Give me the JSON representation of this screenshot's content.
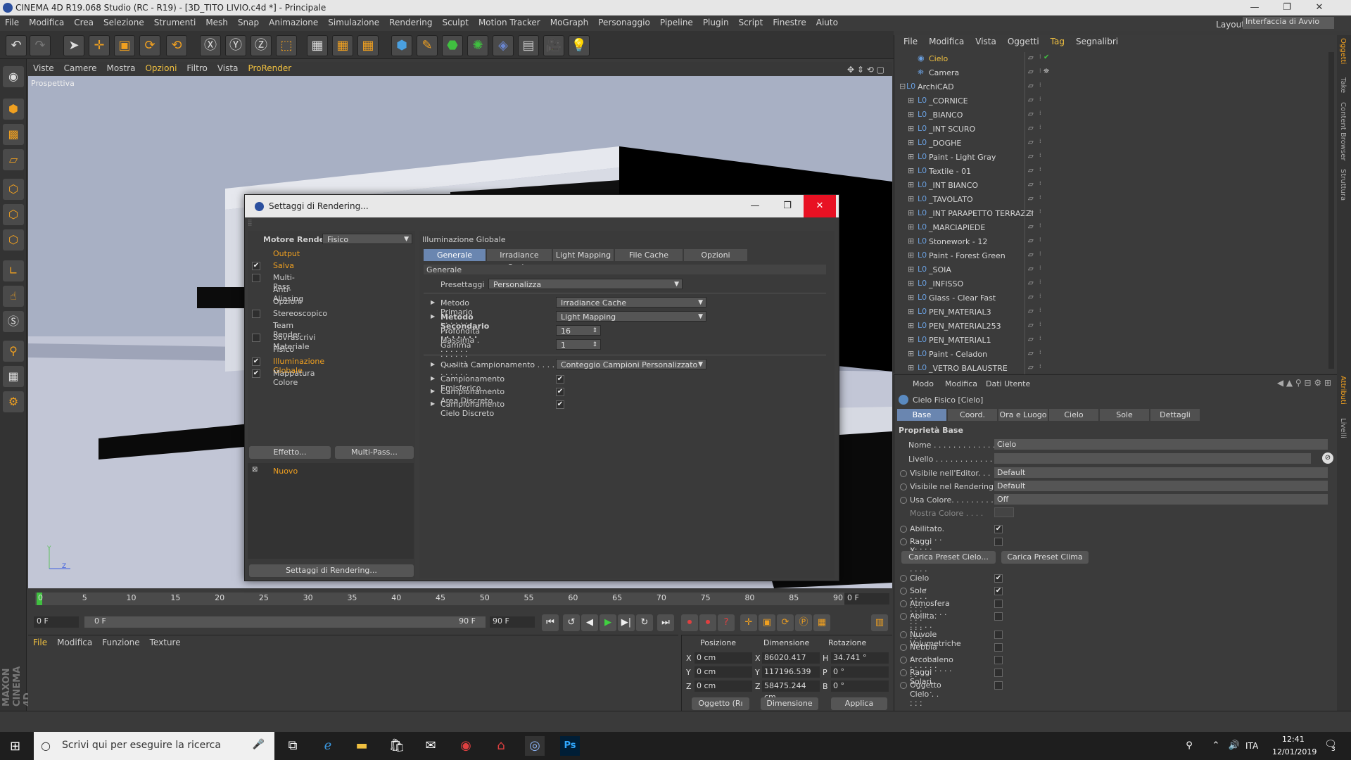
{
  "window": {
    "title": "CINEMA 4D R19.068 Studio (RC - R19) - [3D_TITO LIVIO.c4d *] - Principale",
    "controls": [
      "—",
      "❐",
      "✕"
    ]
  },
  "menubar": {
    "items": [
      "File",
      "Modifica",
      "Crea",
      "Selezione",
      "Strumenti",
      "Mesh",
      "Snap",
      "Animazione",
      "Simulazione",
      "Rendering",
      "Sculpt",
      "Motion Tracker",
      "MoGraph",
      "Personaggio",
      "Pipeline",
      "Plugin",
      "Script",
      "Finestre",
      "Aiuto"
    ],
    "layout_label": "Layout:",
    "layout_value": "Interfaccia di Avvio"
  },
  "viewport": {
    "menu": [
      "Viste",
      "Camere",
      "Mostra",
      "Opzioni",
      "Filtro",
      "Vista",
      "ProRender"
    ],
    "label": "Prospettiva",
    "axis_y": "Y",
    "axis_z": "Z"
  },
  "timeline": {
    "ticks": [
      "0",
      "5",
      "10",
      "15",
      "20",
      "25",
      "30",
      "35",
      "40",
      "45",
      "50",
      "55",
      "60",
      "65",
      "70",
      "75",
      "80",
      "85",
      "90"
    ],
    "frame_end_box": "0 F",
    "start": "0 F",
    "range_start": "0 F",
    "range_end": "90 F",
    "end": "90 F"
  },
  "material_manager": {
    "menu": [
      "File",
      "Modifica",
      "Funzione",
      "Texture"
    ]
  },
  "coordinates": {
    "headers": [
      "Posizione",
      "Dimensione",
      "Rotazione"
    ],
    "rows": [
      {
        "axis": "X",
        "pos": "0 cm",
        "dim_axis": "X",
        "dim": "86020.417 cm",
        "rot_axis": "H",
        "rot": "34.741 °"
      },
      {
        "axis": "Y",
        "pos": "0 cm",
        "dim_axis": "Y",
        "dim": "117196.539 cı",
        "rot_axis": "P",
        "rot": "0 °"
      },
      {
        "axis": "Z",
        "pos": "0 cm",
        "dim_axis": "Z",
        "dim": "58475.244 cm",
        "rot_axis": "B",
        "rot": "0 °"
      }
    ],
    "mode_select": "Oggetto (Rı",
    "size_select": "Dimensione",
    "apply": "Applica"
  },
  "object_manager": {
    "menu": [
      "File",
      "Modifica",
      "Vista",
      "Oggetti",
      "Tag",
      "Segnalibri"
    ],
    "objects": [
      {
        "name": "Cielo",
        "expand": ""
      },
      {
        "name": "Camera",
        "expand": ""
      },
      {
        "name": "ArchiCAD",
        "expand": "⊟"
      },
      {
        "name": "_CORNICE",
        "expand": "⊞"
      },
      {
        "name": "_BIANCO",
        "expand": "⊞"
      },
      {
        "name": "_INT SCURO",
        "expand": "⊞"
      },
      {
        "name": "_DOGHE",
        "expand": "⊞"
      },
      {
        "name": "Paint - Light Gray",
        "expand": "⊞"
      },
      {
        "name": "Textile - 01",
        "expand": "⊞"
      },
      {
        "name": "_INT BIANCO",
        "expand": "⊞"
      },
      {
        "name": "_TAVOLATO",
        "expand": "⊞"
      },
      {
        "name": "_INT PARAPETTO TERRAZZI",
        "expand": "⊞"
      },
      {
        "name": "_MARCIAPIEDE",
        "expand": "⊞"
      },
      {
        "name": "Stonework - 12",
        "expand": "⊞"
      },
      {
        "name": "Paint - Forest Green",
        "expand": "⊞"
      },
      {
        "name": "_SOIA",
        "expand": "⊞"
      },
      {
        "name": "_INFISSO",
        "expand": "⊞"
      },
      {
        "name": "Glass - Clear Fast",
        "expand": "⊞"
      },
      {
        "name": "PEN_MATERIAL3",
        "expand": "⊞"
      },
      {
        "name": "PEN_MATERIAL253",
        "expand": "⊞"
      },
      {
        "name": "PEN_MATERIAL1",
        "expand": "⊞"
      },
      {
        "name": "Paint - Celadon",
        "expand": "⊞"
      },
      {
        "name": "_VETRO BALAUSTRE",
        "expand": "⊞"
      }
    ]
  },
  "attribute_manager": {
    "menu": [
      "Modo",
      "Modifica",
      "Dati Utente"
    ],
    "object_title": "Cielo Fisico [Cielo]",
    "tabs": [
      "Base",
      "Coord.",
      "Ora e Luogo",
      "Cielo",
      "Sole",
      "Dettagli"
    ],
    "section": "Proprietà Base",
    "fields": [
      {
        "label": "Nome . . . . . . . . . . . . . . .",
        "value": "Cielo"
      },
      {
        "label": "Livello . . . . . . . . . . . . . .",
        "value": ""
      },
      {
        "label": "Visibile nell'Editor. . .",
        "value": "Default"
      },
      {
        "label": "Visibile nel Rendering",
        "value": "Default"
      },
      {
        "label": "Usa Colore. . . . . . . . . .",
        "value": "Off"
      },
      {
        "label": "Mostra Colore . . . .",
        "value": ""
      }
    ],
    "checks1": [
      {
        "label": "Abilitato. . . . . . . . . . . . .",
        "checked": "✔"
      },
      {
        "label": "Raggi X. . . . . . . . . . . . . .",
        "checked": ""
      }
    ],
    "preset_buttons": [
      "Carica Preset Cielo...",
      "Carica Preset Clima"
    ],
    "checks2": [
      {
        "label": "Cielo . . . . . . . . . . . . . . . .",
        "checked": "✔"
      },
      {
        "label": "Sole . . . . . . . . . . . . . . . .",
        "checked": "✔"
      },
      {
        "label": "Atmosfera . . . . . . . . . .",
        "checked": ""
      },
      {
        "label": "Abilita. . . . . . . . . . . . . .",
        "checked": ""
      }
    ],
    "checks3": [
      {
        "label": "Nuvole Volumetriche",
        "checked": ""
      },
      {
        "label": "Nebbia . . . . . . . . . . . . . .",
        "checked": ""
      },
      {
        "label": "Arcobaleno . . . . . . . . .",
        "checked": ""
      },
      {
        "label": "Raggi Solari. . . . . . . . .",
        "checked": ""
      },
      {
        "label": "Oggetto Cielo . . . . .",
        "checked": ""
      }
    ]
  },
  "right_strip": [
    "Oggetti",
    "Take",
    "Content Browser",
    "Struttura",
    "Attributi",
    "Livelli"
  ],
  "dialog": {
    "title": "Settaggi di Rendering...",
    "render_engine_label": "Motore Render",
    "render_engine_value": "Fisico",
    "left_items": [
      {
        "label": "Output",
        "check": "",
        "hl": true
      },
      {
        "label": "Salva",
        "check": "✔",
        "hl": true
      },
      {
        "label": "Multi-Pass",
        "check": "box",
        "hl": false
      },
      {
        "label": "Anti-Aliasing",
        "check": "",
        "hl": false
      },
      {
        "label": "Opzioni",
        "check": "",
        "hl": false
      },
      {
        "label": "Stereoscopico",
        "check": "box",
        "hl": false
      },
      {
        "label": "Team Render",
        "check": "",
        "hl": false
      },
      {
        "label": "Sovrascrivi Materiale",
        "check": "box",
        "hl": false
      },
      {
        "label": "Fisico",
        "check": "",
        "hl": false
      },
      {
        "label": "Illuminazione Globale",
        "check": "✔",
        "hl": true
      },
      {
        "label": "Mappatura Colore",
        "check": "✔",
        "hl": false
      }
    ],
    "effect_button": "Effetto...",
    "multipass_button": "Multi-Pass...",
    "new_item": "Nuovo",
    "footer_button": "Settaggi di Rendering...",
    "panel_title": "Illuminazione Globale",
    "tabs": [
      "Generale",
      "Irradiance Cache",
      "Light Mapping",
      "File Cache",
      "Opzioni"
    ],
    "section": "Generale",
    "preset_label": "Presettaggi",
    "preset_value": "Personalizza",
    "rows": [
      {
        "label": "Metodo Primario . . . . . . . . . .",
        "value": "Irradiance Cache",
        "bold": false
      },
      {
        "label": "Metodo Secondario . . . . . . .",
        "value": "Light Mapping",
        "bold": true
      },
      {
        "label": "Profondità Massima . . . . . . .",
        "value": "16",
        "bold": false
      },
      {
        "label": "Gamma . . . . . . . . . . . . . . . . . .",
        "value": "1",
        "bold": false
      }
    ],
    "quality_label": "Qualità Campionamento . . . . .",
    "quality_value": "Conteggio Campioni Personalizzato",
    "checks": [
      {
        "label": "Campionamento Emisferico . . .",
        "checked": "✔"
      },
      {
        "label": "Campionamento Area Discreto",
        "checked": "✔"
      },
      {
        "label": "Campionamento Cielo Discreto",
        "checked": "✔"
      }
    ]
  },
  "taskbar": {
    "search_placeholder": "Scrivi qui per eseguire la ricerca",
    "lang": "ITA",
    "time": "12:41",
    "date": "12/01/2019",
    "notif": "3"
  }
}
